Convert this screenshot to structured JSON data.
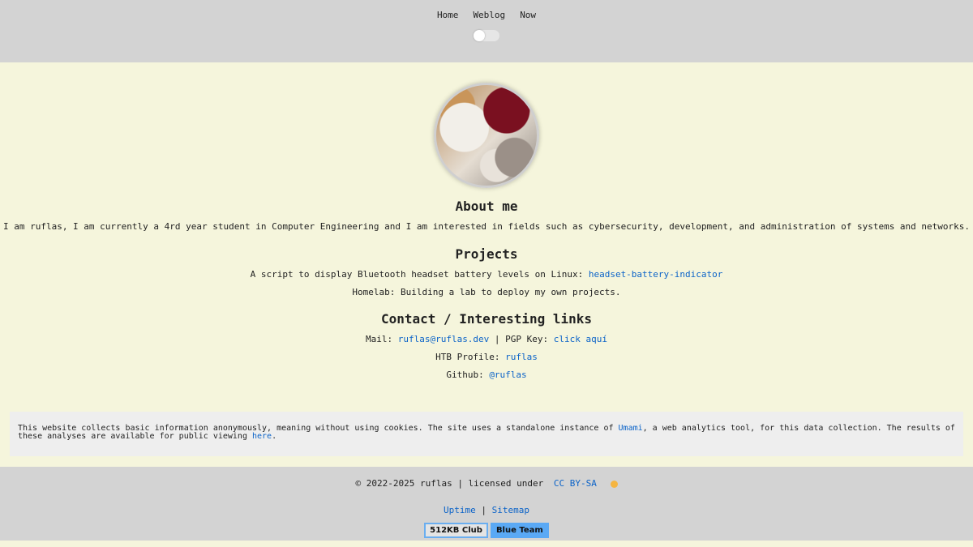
{
  "nav": {
    "items": [
      "Home",
      "Weblog",
      "Now"
    ]
  },
  "about": {
    "heading": "About me",
    "text": "I am ruflas, I am currently a 4rd year student in Computer Engineering and I am interested in fields such as cybersecurity, development, and administration of systems and networks."
  },
  "projects": {
    "heading": "Projects",
    "item1_prefix": "A script to display Bluetooth headset battery levels on Linux: ",
    "item1_link": "headset-battery-indicator",
    "item2": "Homelab: Building a lab to deploy my own projects."
  },
  "contact": {
    "heading": "Contact / Interesting links",
    "mail_label": "Mail: ",
    "mail_link": "ruflas@ruflas.dev",
    "pgp_label": " | PGP Key: ",
    "pgp_link": "click aquí",
    "htb_label": "HTB Profile: ",
    "htb_link": "ruflas",
    "github_label": "Github: ",
    "github_link": "@ruflas"
  },
  "notice": {
    "part1": "This website collects basic information anonymously, meaning without using cookies. The site uses a standalone instance of ",
    "umami_link": "Umami",
    "part2": ", a web analytics tool, for this data collection. The results of these analyses are available for public viewing ",
    "here_link": "here",
    "part3": "."
  },
  "footer": {
    "copyright": "© 2022-2025 ruflas | licensed under",
    "license_link": "CC BY-SA",
    "uptime_link": "Uptime",
    "separator": "|",
    "sitemap_link": "Sitemap",
    "badge_club": "512KB Club",
    "badge_blue": "Blue Team"
  },
  "theme": {
    "background": "#f5f5dc",
    "header": "#d3d3d3",
    "link": "#0b63c8"
  }
}
